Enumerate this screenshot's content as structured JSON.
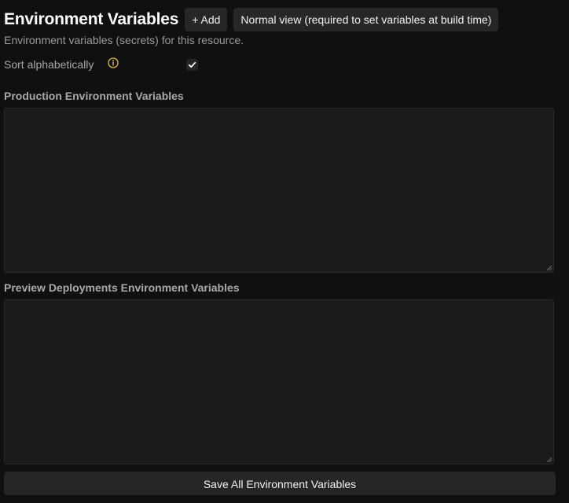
{
  "header": {
    "title": "Environment Variables",
    "add_button": "+ Add",
    "view_button": "Normal view (required to set variables at build time)"
  },
  "subtitle": "Environment variables (secrets) for this resource.",
  "sort": {
    "label": "Sort alphabetically",
    "checked": true,
    "info_icon": "info-icon",
    "accent_color": "#e5b93a"
  },
  "production": {
    "label": "Production Environment Variables",
    "value": ""
  },
  "preview": {
    "label": "Preview Deployments Environment Variables",
    "value": ""
  },
  "save_button": "Save All Environment Variables"
}
